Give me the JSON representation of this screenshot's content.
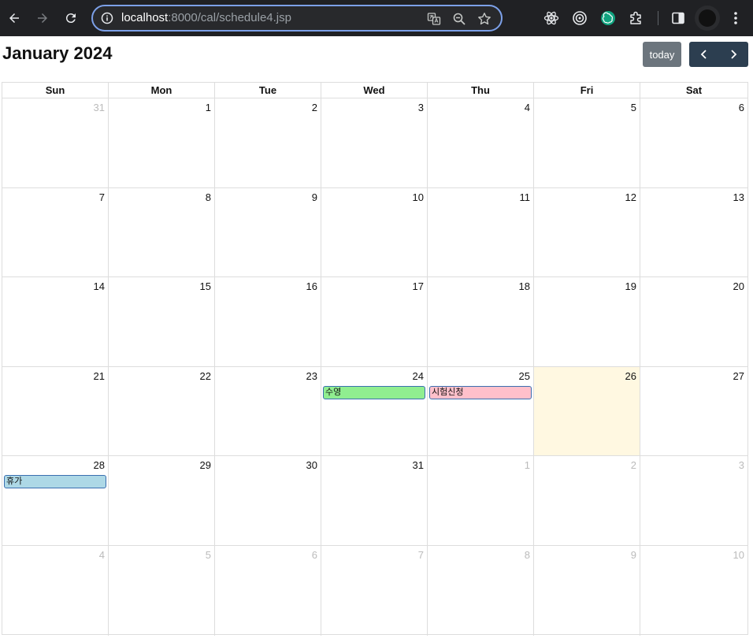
{
  "browser": {
    "url_host": "localhost",
    "url_rest": ":8000/cal/schedule4.jsp"
  },
  "calendar": {
    "title": "January 2024",
    "today_label": "today",
    "weekdays": [
      "Sun",
      "Mon",
      "Tue",
      "Wed",
      "Thu",
      "Fri",
      "Sat"
    ],
    "weeks": [
      [
        {
          "d": "31",
          "other": true
        },
        {
          "d": "1"
        },
        {
          "d": "2"
        },
        {
          "d": "3"
        },
        {
          "d": "4"
        },
        {
          "d": "5"
        },
        {
          "d": "6"
        }
      ],
      [
        {
          "d": "7"
        },
        {
          "d": "8"
        },
        {
          "d": "9"
        },
        {
          "d": "10"
        },
        {
          "d": "11"
        },
        {
          "d": "12"
        },
        {
          "d": "13"
        }
      ],
      [
        {
          "d": "14"
        },
        {
          "d": "15"
        },
        {
          "d": "16"
        },
        {
          "d": "17"
        },
        {
          "d": "18"
        },
        {
          "d": "19"
        },
        {
          "d": "20"
        }
      ],
      [
        {
          "d": "21"
        },
        {
          "d": "22"
        },
        {
          "d": "23"
        },
        {
          "d": "24",
          "event": {
            "title": "수영",
            "color": "#90ee90"
          }
        },
        {
          "d": "25",
          "event": {
            "title": "시험신청",
            "color": "#ffc0cb"
          }
        },
        {
          "d": "26",
          "today": true
        },
        {
          "d": "27"
        }
      ],
      [
        {
          "d": "28",
          "event": {
            "title": "휴가",
            "color": "#add8e6"
          }
        },
        {
          "d": "29"
        },
        {
          "d": "30"
        },
        {
          "d": "31"
        },
        {
          "d": "1",
          "other": true
        },
        {
          "d": "2",
          "other": true
        },
        {
          "d": "3",
          "other": true
        }
      ],
      [
        {
          "d": "4",
          "other": true
        },
        {
          "d": "5",
          "other": true
        },
        {
          "d": "6",
          "other": true
        },
        {
          "d": "7",
          "other": true
        },
        {
          "d": "8",
          "other": true
        },
        {
          "d": "9",
          "other": true
        },
        {
          "d": "10",
          "other": true
        }
      ]
    ]
  },
  "colors": {
    "chrome_bg": "#202124",
    "today_bg": "#fff8e1",
    "nav_btn_bg": "#2c3e50",
    "today_btn_bg": "#6c757d"
  }
}
